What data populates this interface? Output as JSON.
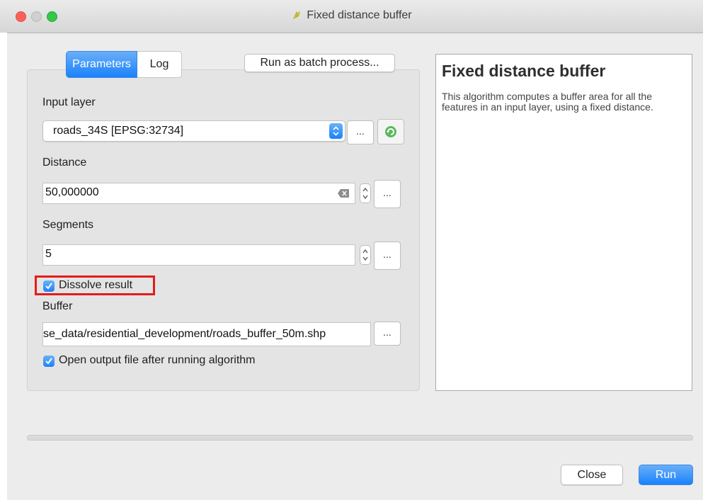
{
  "window": {
    "title": "Fixed distance buffer"
  },
  "tabs": [
    {
      "label": "Parameters",
      "active": true
    },
    {
      "label": "Log",
      "active": false
    }
  ],
  "batch_button": "Run as batch process...",
  "params": {
    "input_layer_label": "Input layer",
    "input_layer_value": "roads_34S [EPSG:32734]",
    "distance_label": "Distance",
    "distance_value": "50,000000",
    "segments_label": "Segments",
    "segments_value": "5",
    "dissolve_label": "Dissolve result",
    "dissolve_checked": true,
    "buffer_label": "Buffer",
    "buffer_value": "se_data/residential_development/roads_buffer_50m.shp",
    "open_output_label": "Open output file after running algorithm",
    "open_output_checked": true,
    "ellipsis": "..."
  },
  "help": {
    "title": "Fixed distance buffer",
    "text": "This algorithm computes a buffer area for all the features in an input layer, using a fixed distance."
  },
  "footer": {
    "close_label": "Close",
    "run_label": "Run"
  },
  "colors": {
    "accent": "#1a82fb",
    "highlight": "#e41b1b"
  },
  "icons": {
    "app": "qgis-icon",
    "refresh": "refresh-icon",
    "clear": "clear-icon",
    "check": "checkmark-icon"
  }
}
